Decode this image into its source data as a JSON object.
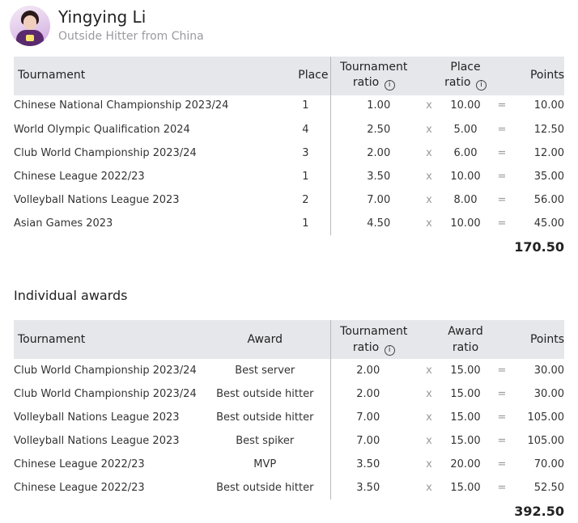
{
  "profile": {
    "name": "Yingying Li",
    "subtitle": "Outside Hitter from China"
  },
  "standings": {
    "headers": {
      "tournament": "Tournament",
      "place": "Place",
      "tournament_ratio": "Tournament ratio",
      "place_ratio": "Place ratio",
      "points": "Points"
    },
    "rows": [
      {
        "tournament": "Chinese National Championship 2023/24",
        "place": "1",
        "tournament_ratio": "1.00",
        "x": "x",
        "place_ratio": "10.00",
        "eq": "=",
        "points": "10.00"
      },
      {
        "tournament": "World Olympic Qualification 2024",
        "place": "4",
        "tournament_ratio": "2.50",
        "x": "x",
        "place_ratio": "5.00",
        "eq": "=",
        "points": "12.50"
      },
      {
        "tournament": "Club World Championship 2023/24",
        "place": "3",
        "tournament_ratio": "2.00",
        "x": "x",
        "place_ratio": "6.00",
        "eq": "=",
        "points": "12.00"
      },
      {
        "tournament": "Chinese League 2022/23",
        "place": "1",
        "tournament_ratio": "3.50",
        "x": "x",
        "place_ratio": "10.00",
        "eq": "=",
        "points": "35.00"
      },
      {
        "tournament": "Volleyball Nations League 2023",
        "place": "2",
        "tournament_ratio": "7.00",
        "x": "x",
        "place_ratio": "8.00",
        "eq": "=",
        "points": "56.00"
      },
      {
        "tournament": "Asian Games 2023",
        "place": "1",
        "tournament_ratio": "4.50",
        "x": "x",
        "place_ratio": "10.00",
        "eq": "=",
        "points": "45.00"
      }
    ],
    "total": "170.50"
  },
  "awards": {
    "title": "Individual awards",
    "headers": {
      "tournament": "Tournament",
      "award": "Award",
      "tournament_ratio": "Tournament ratio",
      "award_ratio": "Award ratio",
      "points": "Points"
    },
    "rows": [
      {
        "tournament": "Club World Championship 2023/24",
        "award": "Best server",
        "tournament_ratio": "2.00",
        "x": "x",
        "award_ratio": "15.00",
        "eq": "=",
        "points": "30.00"
      },
      {
        "tournament": "Club World Championship 2023/24",
        "award": "Best outside hitter",
        "tournament_ratio": "2.00",
        "x": "x",
        "award_ratio": "15.00",
        "eq": "=",
        "points": "30.00"
      },
      {
        "tournament": "Volleyball Nations League 2023",
        "award": "Best outside hitter",
        "tournament_ratio": "7.00",
        "x": "x",
        "award_ratio": "15.00",
        "eq": "=",
        "points": "105.00"
      },
      {
        "tournament": "Volleyball Nations League 2023",
        "award": "Best spiker",
        "tournament_ratio": "7.00",
        "x": "x",
        "award_ratio": "15.00",
        "eq": "=",
        "points": "105.00"
      },
      {
        "tournament": "Chinese League 2022/23",
        "award": "MVP",
        "tournament_ratio": "3.50",
        "x": "x",
        "award_ratio": "20.00",
        "eq": "=",
        "points": "70.00"
      },
      {
        "tournament": "Chinese League 2022/23",
        "award": "Best outside hitter",
        "tournament_ratio": "3.50",
        "x": "x",
        "award_ratio": "15.00",
        "eq": "=",
        "points": "52.50"
      }
    ],
    "total": "392.50"
  },
  "icons": {
    "info": "info-icon"
  },
  "colors": {
    "header_bg": "#e5e7eb",
    "subtitle": "#9a9aa0",
    "text": "#222222"
  }
}
